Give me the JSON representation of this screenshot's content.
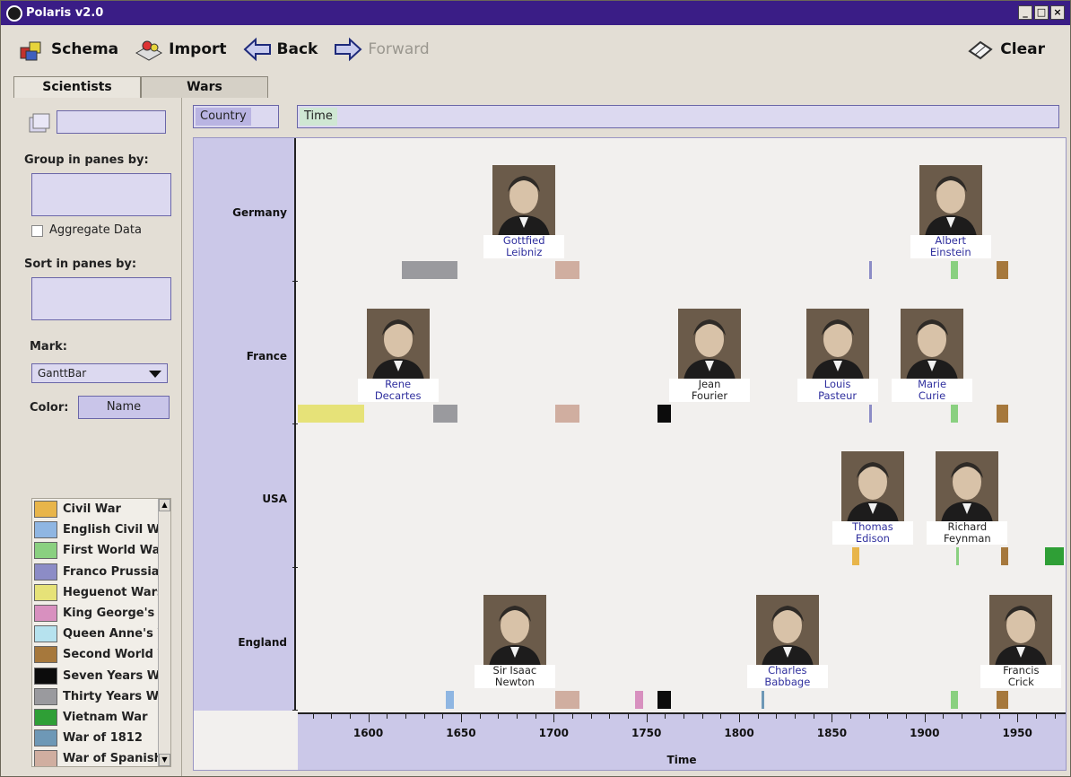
{
  "window": {
    "title": "Polaris v2.0",
    "btn_min": "_",
    "btn_max": "□",
    "btn_close": "×"
  },
  "toolbar": {
    "schema": "Schema",
    "import": "Import",
    "back": "Back",
    "forward": "Forward",
    "clear": "Clear"
  },
  "tabs": [
    "Scientists",
    "Wars"
  ],
  "left": {
    "group_label": "Group in panes by:",
    "aggregate_label": "Aggregate Data",
    "sort_label": "Sort in panes by:",
    "mark_label": "Mark:",
    "mark_value": "GanttBar",
    "color_label": "Color:",
    "color_value": "Name"
  },
  "legend": [
    {
      "label": "Civil War",
      "color": "#e8b54a"
    },
    {
      "label": "English Civil War",
      "color": "#8fb6e2"
    },
    {
      "label": "First World War",
      "color": "#8ad080"
    },
    {
      "label": "Franco Prussian War",
      "color": "#8c8cc6"
    },
    {
      "label": "Heguenot Wars",
      "color": "#e6e278"
    },
    {
      "label": "King George's War",
      "color": "#d890bf"
    },
    {
      "label": "Queen Anne's War",
      "color": "#b6e2ee"
    },
    {
      "label": "Second World War",
      "color": "#a6783c"
    },
    {
      "label": "Seven Years War",
      "color": "#0c0c0c"
    },
    {
      "label": "Thirty Years War",
      "color": "#9a9a9e"
    },
    {
      "label": "Vietnam War",
      "color": "#2f9f36"
    },
    {
      "label": "War of 1812",
      "color": "#6e98b6"
    },
    {
      "label": "War of Spanish Succession",
      "color": "#d0aea0"
    }
  ],
  "shelves": {
    "rows": "Country",
    "columns": "Time"
  },
  "axis": {
    "title": "Time",
    "ticks": [
      "1600",
      "1650",
      "1700",
      "1750",
      "1800",
      "1850",
      "1900",
      "1950"
    ],
    "tick_years": [
      1600,
      1650,
      1700,
      1750,
      1800,
      1850,
      1900,
      1950
    ],
    "x_domain": [
      1562,
      1977
    ]
  },
  "rows": [
    "Germany",
    "France",
    "USA",
    "England"
  ],
  "chart_data": {
    "type": "gantt",
    "x_axis": "Time",
    "y_axis": "Country",
    "bars": [
      {
        "row": "Germany",
        "war": "Thirty Years War",
        "start": 1618,
        "end": 1648,
        "color": "#9a9a9e"
      },
      {
        "row": "Germany",
        "war": "War of Spanish Succession",
        "start": 1701,
        "end": 1714,
        "color": "#d0aea0"
      },
      {
        "row": "Germany",
        "war": "Franco Prussian War",
        "start": 1870,
        "end": 1871,
        "color": "#8c8cc6"
      },
      {
        "row": "Germany",
        "war": "First World War",
        "start": 1914,
        "end": 1918,
        "color": "#8ad080"
      },
      {
        "row": "Germany",
        "war": "Second World War",
        "start": 1939,
        "end": 1945,
        "color": "#a6783c"
      },
      {
        "row": "France",
        "war": "Heguenot Wars",
        "start": 1562,
        "end": 1598,
        "color": "#e6e278"
      },
      {
        "row": "France",
        "war": "Thirty Years War",
        "start": 1635,
        "end": 1648,
        "color": "#9a9a9e"
      },
      {
        "row": "France",
        "war": "War of Spanish Succession",
        "start": 1701,
        "end": 1714,
        "color": "#d0aea0"
      },
      {
        "row": "France",
        "war": "Seven Years War",
        "start": 1756,
        "end": 1763,
        "color": "#0c0c0c"
      },
      {
        "row": "France",
        "war": "Franco Prussian War",
        "start": 1870,
        "end": 1871,
        "color": "#8c8cc6"
      },
      {
        "row": "France",
        "war": "First World War",
        "start": 1914,
        "end": 1918,
        "color": "#8ad080"
      },
      {
        "row": "France",
        "war": "Second World War",
        "start": 1939,
        "end": 1945,
        "color": "#a6783c"
      },
      {
        "row": "USA",
        "war": "Civil War",
        "start": 1861,
        "end": 1865,
        "color": "#e8b54a"
      },
      {
        "row": "USA",
        "war": "First World War",
        "start": 1917,
        "end": 1918,
        "color": "#8ad080"
      },
      {
        "row": "USA",
        "war": "Second World War",
        "start": 1941,
        "end": 1945,
        "color": "#a6783c"
      },
      {
        "row": "USA",
        "war": "Vietnam War",
        "start": 1965,
        "end": 1975,
        "color": "#2f9f36"
      },
      {
        "row": "England",
        "war": "English Civil War",
        "start": 1642,
        "end": 1646,
        "color": "#8fb6e2"
      },
      {
        "row": "England",
        "war": "War of Spanish Succession",
        "start": 1701,
        "end": 1714,
        "color": "#d0aea0"
      },
      {
        "row": "England",
        "war": "King George's War",
        "start": 1744,
        "end": 1748,
        "color": "#d890bf"
      },
      {
        "row": "England",
        "war": "Seven Years War",
        "start": 1756,
        "end": 1763,
        "color": "#0c0c0c"
      },
      {
        "row": "England",
        "war": "War of 1812",
        "start": 1812,
        "end": 1813,
        "color": "#6e98b6"
      },
      {
        "row": "England",
        "war": "First World War",
        "start": 1914,
        "end": 1918,
        "color": "#8ad080"
      },
      {
        "row": "England",
        "war": "Second World War",
        "start": 1939,
        "end": 1945,
        "color": "#a6783c"
      }
    ]
  },
  "scientists": [
    {
      "row": "Germany",
      "name": [
        "Gottfied",
        "Leibniz"
      ],
      "year": 1684,
      "color": "blue"
    },
    {
      "row": "Germany",
      "name": [
        "Albert",
        "Einstein"
      ],
      "year": 1914,
      "color": "blue"
    },
    {
      "row": "France",
      "name": [
        "Rene",
        "Decartes"
      ],
      "year": 1616,
      "color": "blue"
    },
    {
      "row": "France",
      "name": [
        "Jean",
        "Fourier"
      ],
      "year": 1784,
      "color": "dark"
    },
    {
      "row": "France",
      "name": [
        "Louis",
        "Pasteur"
      ],
      "year": 1853,
      "color": "blue"
    },
    {
      "row": "France",
      "name": [
        "Marie",
        "Curie"
      ],
      "year": 1904,
      "color": "blue"
    },
    {
      "row": "USA",
      "name": [
        "Thomas",
        "Edison"
      ],
      "year": 1872,
      "color": "blue"
    },
    {
      "row": "USA",
      "name": [
        "Richard",
        "Feynman"
      ],
      "year": 1923,
      "color": "dark"
    },
    {
      "row": "England",
      "name": [
        "Sir Isaac",
        "Newton"
      ],
      "year": 1679,
      "color": "dark"
    },
    {
      "row": "England",
      "name": [
        "Charles",
        "Babbage"
      ],
      "year": 1826,
      "color": "blue"
    },
    {
      "row": "England",
      "name": [
        "Francis",
        "Crick"
      ],
      "year": 1952,
      "color": "dark"
    }
  ]
}
